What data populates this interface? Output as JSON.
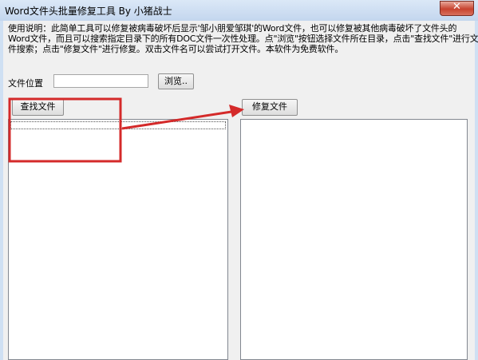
{
  "window": {
    "title": "Word文件头批量修复工具  By 小猪战士",
    "close_glyph": "✕"
  },
  "description": {
    "lines": [
      "使用说明：此简单工具可以修复被病毒破坏后显示'邹小朋爱邹琪'的Word文件，也可以修复被其他病毒破坏了文件头的",
      "Word文件，而且可以搜索指定目录下的所有DOC文件一次性处理。点\"浏览\"按钮选择文件所在目录，点击\"查找文件\"进行文",
      "件搜索；点击\"修复文件\"进行修复。双击文件名可以尝试打开文件。本软件为免费软件。"
    ]
  },
  "location": {
    "label": "文件位置",
    "value": "",
    "browse_label": "浏览.."
  },
  "buttons": {
    "find_label": "查找文件",
    "repair_label": "修复文件"
  },
  "annotation": {
    "color": "#d42a2a"
  }
}
